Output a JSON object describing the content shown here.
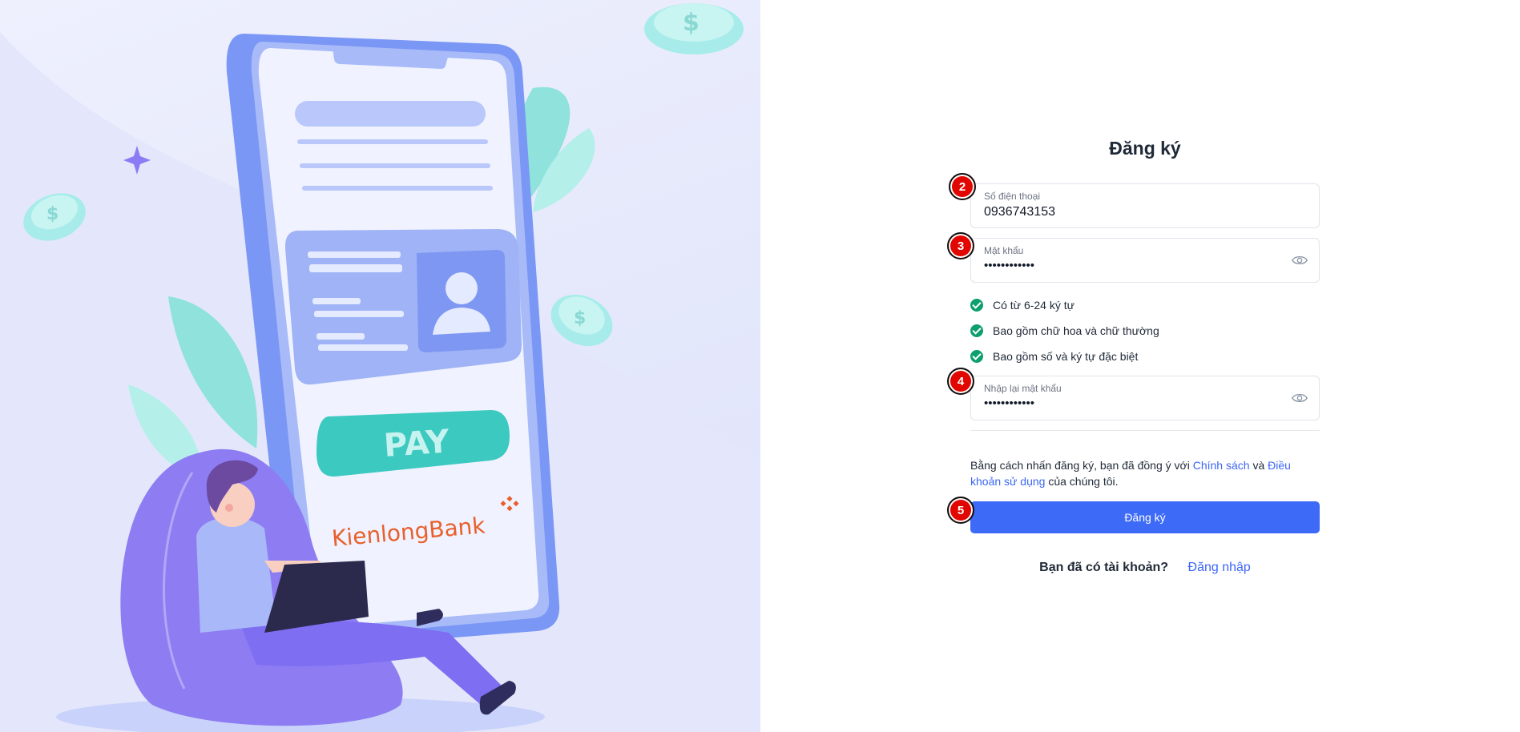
{
  "brand": {
    "name": "KienlongBank"
  },
  "illustration": {
    "pay_label": "PAY"
  },
  "form": {
    "title": "Đăng ký",
    "phone": {
      "label": "Số điện thoại",
      "value": "0936743153"
    },
    "password": {
      "label": "Mật khẩu",
      "value": "••••••••••••"
    },
    "confirm": {
      "label": "Nhập lại mật khẩu",
      "value": "••••••••••••"
    },
    "rules": [
      "Có từ 6-24 ký tự",
      "Bao gồm chữ hoa và chữ thường",
      "Bao gồm số và ký tự đặc biệt"
    ],
    "terms": {
      "prefix": "Bằng cách nhấn đăng ký, bạn đã đồng ý với",
      "policy_link": "Chính sách",
      "and": "và",
      "terms_link": "Điều khoản sử dụng",
      "suffix": "của chúng tôi."
    },
    "submit_label": "Đăng ký",
    "login_question": "Bạn đã có tài khoản?",
    "login_link": "Đăng nhập"
  },
  "annotations": [
    "2",
    "3",
    "4",
    "5"
  ],
  "colors": {
    "primary": "#3d6bf7",
    "success": "#0e9f6e",
    "badge": "#e10600"
  }
}
